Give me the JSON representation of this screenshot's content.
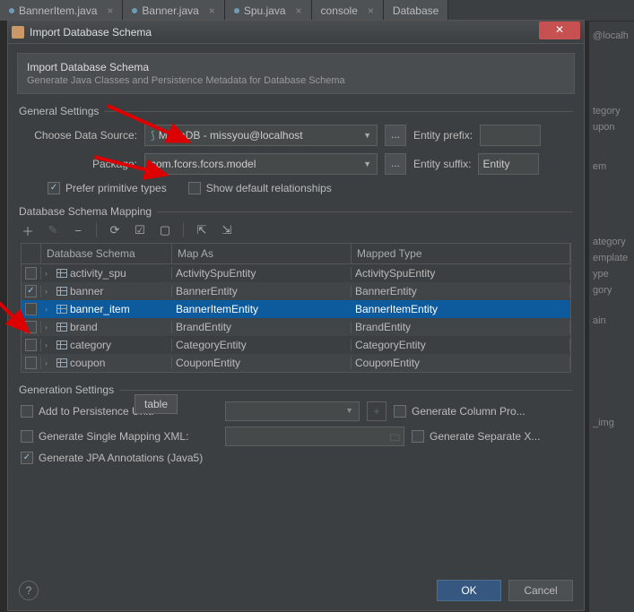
{
  "bg": {
    "tabs": [
      "BannerItem.java",
      "Banner.java",
      "Spu.java",
      "console",
      "Database"
    ],
    "right": [
      "@localh",
      "tegory",
      "upon",
      "em",
      "ategory",
      "emplate",
      "ype",
      "gory",
      "ain",
      "_img"
    ]
  },
  "dialog": {
    "title": "Import Database Schema",
    "banner": {
      "title": "Import Database Schema",
      "sub": "Generate Java Classes and Persistence Metadata for Database Schema"
    },
    "sect_general": "General Settings",
    "datasource_label": "Choose Data Source:",
    "datasource_value": "MariaDB - missyou@localhost",
    "package_label": "Package:",
    "package_value": "com.fcors.fcors.model",
    "prefix_label": "Entity prefix:",
    "prefix_value": "",
    "suffix_label": "Entity suffix:",
    "suffix_value": "Entity",
    "prefer_primitive": "Prefer primitive types",
    "show_default_rel": "Show default relationships",
    "sect_mapping": "Database Schema Mapping",
    "columns": {
      "schema": "Database Schema",
      "mapas": "Map As",
      "mapped": "Mapped Type"
    },
    "rows": [
      {
        "checked": false,
        "name": "activity_spu",
        "mapas": "ActivitySpuEntity",
        "mapped": "ActivitySpuEntity",
        "selected": false
      },
      {
        "checked": true,
        "name": "banner",
        "mapas": "BannerEntity",
        "mapped": "BannerEntity",
        "selected": false
      },
      {
        "checked": false,
        "name": "banner_item",
        "mapas": "BannerItemEntity",
        "mapped": "BannerItemEntity",
        "selected": true
      },
      {
        "checked": false,
        "name": "brand",
        "mapas": "BrandEntity",
        "mapped": "BrandEntity",
        "selected": false
      },
      {
        "checked": false,
        "name": "category",
        "mapas": "CategoryEntity",
        "mapped": "CategoryEntity",
        "selected": false
      },
      {
        "checked": false,
        "name": "coupon",
        "mapas": "CouponEntity",
        "mapped": "CouponEntity",
        "selected": false
      }
    ],
    "tooltip": "table",
    "sect_gen": "Generation Settings",
    "gen": {
      "add_pu": "Add to Persistence Unit:",
      "gen_col": "Generate Column Pro...",
      "gen_single": "Generate Single Mapping XML:",
      "gen_sep": "Generate Separate X...",
      "gen_jpa": "Generate JPA Annotations (Java5)"
    },
    "footer": {
      "ok": "OK",
      "cancel": "Cancel",
      "help": "?"
    }
  }
}
